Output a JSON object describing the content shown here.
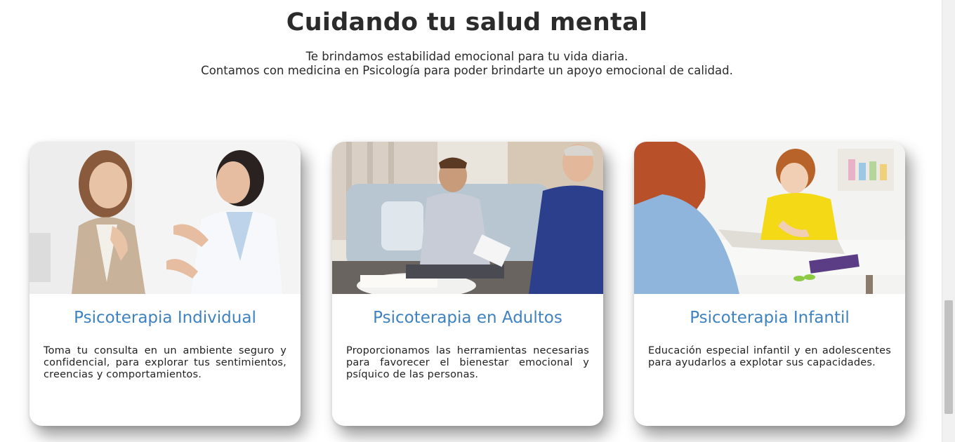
{
  "section": {
    "title": "Cuidando tu salud mental",
    "subtitle_line1": "Te brindamos estabilidad emocional para tu vida diaria.",
    "subtitle_line2": "Contamos con medicina en Psicología para poder brindarte un apoyo emocional de calidad."
  },
  "cards": [
    {
      "title": "Psicoterapia Individual",
      "text": "Toma tu consulta en un ambiente seguro y confidencial, para explorar tus sentimientos, creencias y comportamientos."
    },
    {
      "title": "Psicoterapia en Adultos",
      "text": "Proporcionamos las herramientas necesarias para favorecer el bienestar emocional y psíquico de las personas."
    },
    {
      "title": "Psicoterapia Infantil",
      "text": "Educación especial infantil y en adolescentes para ayudarlos a explotar sus capacidades."
    }
  ],
  "colors": {
    "accent": "#3e82c2",
    "heading": "#2b2b2b",
    "text": "#222222"
  }
}
